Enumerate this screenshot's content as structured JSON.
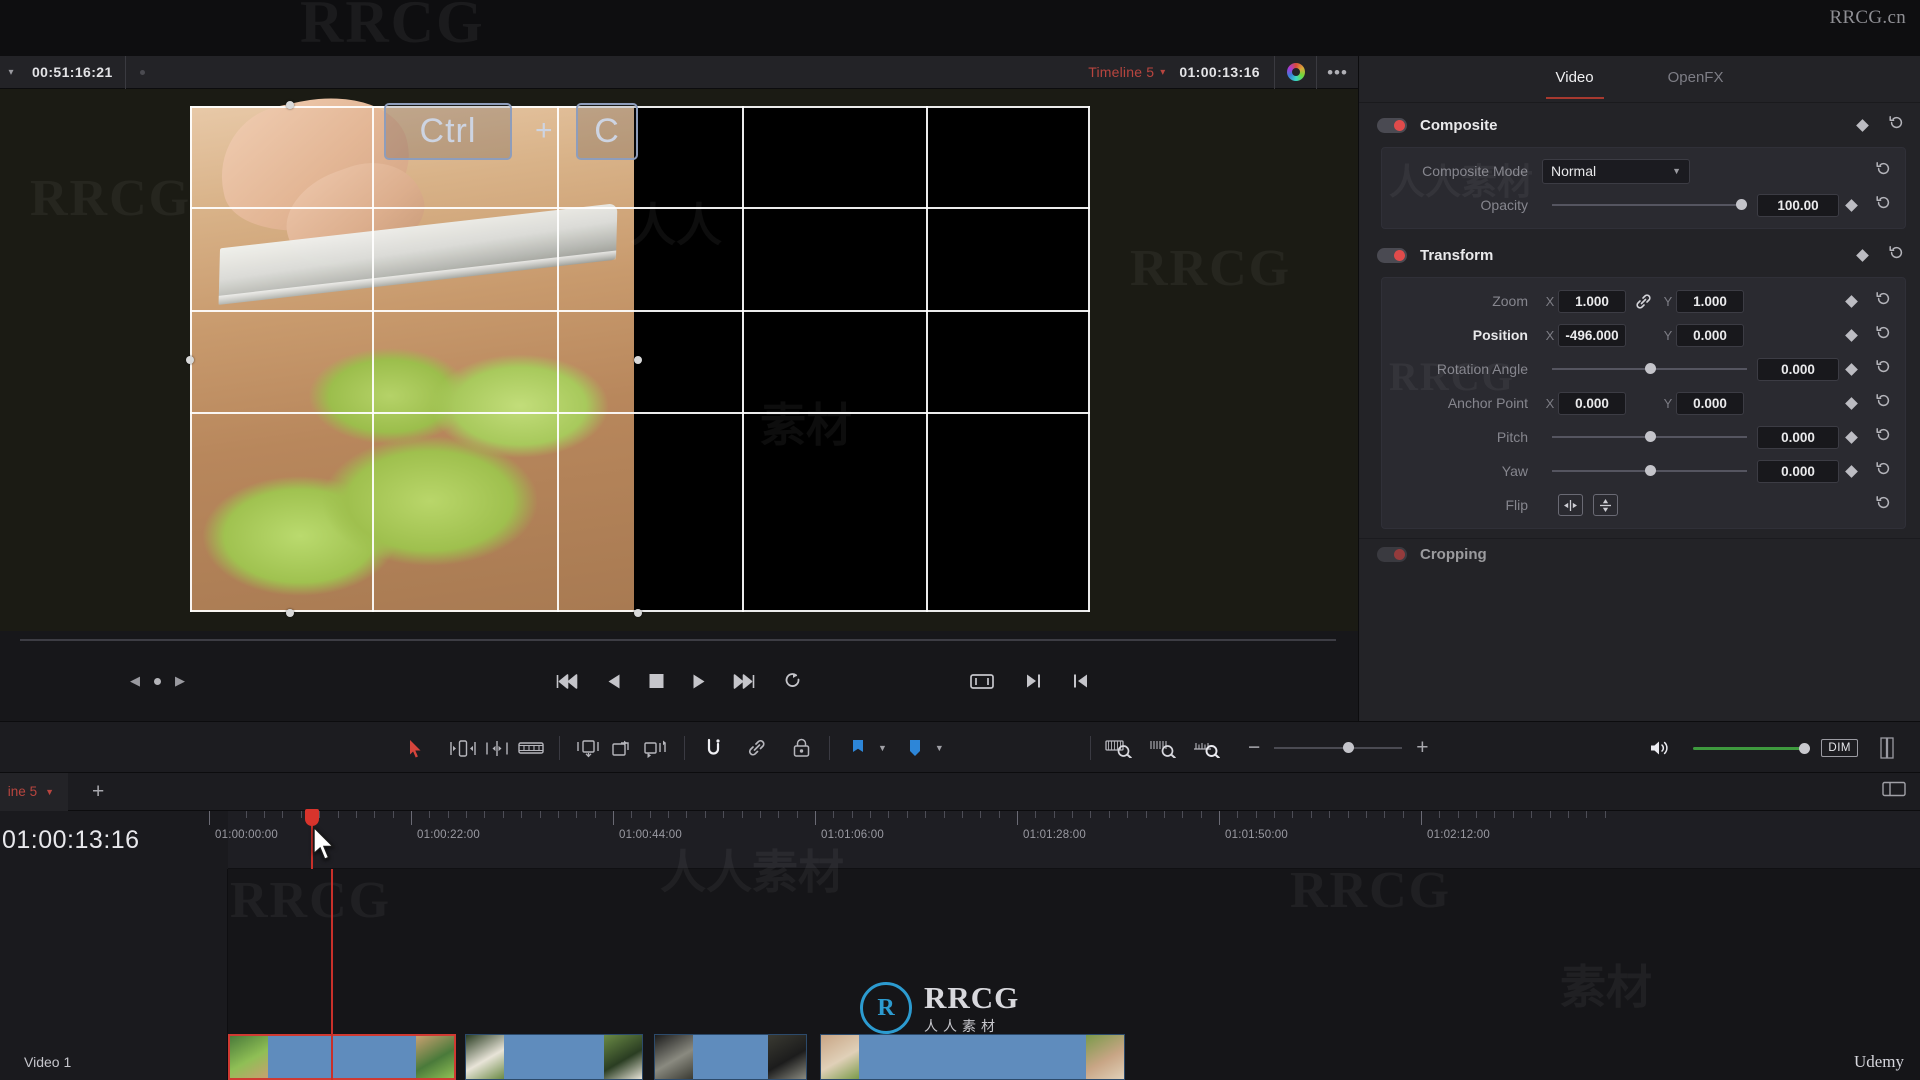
{
  "branding": {
    "top_right_watermark": "RRCG.cn",
    "bottom_right": "Udemy",
    "logo_mark": "R",
    "logo_text": "RRCG",
    "logo_subtext": "人人素材",
    "watermark_text": "RRCG",
    "watermark_cn": "人人素材"
  },
  "viewer": {
    "source_timecode": "00:51:16:21",
    "timeline_name": "Timeline 5",
    "current_timecode": "01:00:13:16",
    "color_icon": "color-wheel-icon",
    "options_icon": "options-ellipsis-icon",
    "key_overlay": {
      "key1": "Ctrl",
      "plus": "+",
      "key2": "C"
    },
    "transport": [
      {
        "name": "skip-to-start-button",
        "glyph": "first-frame"
      },
      {
        "name": "play-reverse-button",
        "glyph": "reverse"
      },
      {
        "name": "stop-button",
        "glyph": "stop"
      },
      {
        "name": "play-forward-button",
        "glyph": "play"
      },
      {
        "name": "skip-to-end-button",
        "glyph": "last-frame"
      },
      {
        "name": "loop-button",
        "glyph": "loop"
      }
    ]
  },
  "inspector": {
    "tabs": [
      {
        "label": "Video",
        "active": true
      },
      {
        "label": "OpenFX",
        "active": false
      }
    ],
    "sections": [
      {
        "title": "Composite",
        "enabled": true,
        "rows": [
          {
            "label": "Composite Mode",
            "type": "select",
            "value": "Normal"
          },
          {
            "label": "Opacity",
            "type": "slider",
            "value": "100.00",
            "knob_pct": 100
          }
        ]
      },
      {
        "title": "Transform",
        "enabled": true,
        "rows": [
          {
            "label": "Zoom",
            "type": "xy",
            "x_axis": "X",
            "x": "1.000",
            "y_axis": "Y",
            "y": "1.000",
            "linked": true
          },
          {
            "label": "Position",
            "type": "xy",
            "x_axis": "X",
            "x": "-496.000",
            "y_axis": "Y",
            "y": "0.000",
            "bold": true
          },
          {
            "label": "Rotation Angle",
            "type": "slider",
            "value": "0.000",
            "knob_pct": 50
          },
          {
            "label": "Anchor Point",
            "type": "xy",
            "x_axis": "X",
            "x": "0.000",
            "y_axis": "Y",
            "y": "0.000"
          },
          {
            "label": "Pitch",
            "type": "slider",
            "value": "0.000",
            "knob_pct": 50
          },
          {
            "label": "Yaw",
            "type": "slider",
            "value": "0.000",
            "knob_pct": 50
          },
          {
            "label": "Flip",
            "type": "flip",
            "h_icon": "flip-horizontal-icon",
            "v_icon": "flip-vertical-icon"
          }
        ]
      },
      {
        "title": "Cropping",
        "enabled": true,
        "rows": []
      }
    ]
  },
  "toolbar": {
    "left_tools": [
      {
        "name": "selection-mode-icon",
        "label": "Selection"
      },
      {
        "name": "trim-edit-mode-icon",
        "label": "Trim Edit Mode"
      },
      {
        "name": "dynamic-trim-mode-icon",
        "label": "Dynamic Trim Mode"
      },
      {
        "name": "razor-edit-icon",
        "label": "Blade Edit Mode"
      },
      {
        "name": "insert-clip-icon",
        "label": "Insert Clip"
      },
      {
        "name": "overwrite-clip-icon",
        "label": "Overwrite Clip"
      },
      {
        "name": "replace-clip-icon",
        "label": "Replace Clip"
      },
      {
        "name": "snapping-icon",
        "label": "Snapping"
      },
      {
        "name": "link-clips-icon",
        "label": "Linked Selection"
      },
      {
        "name": "lock-track-icon",
        "label": "Position Lock"
      },
      {
        "name": "flag-icon",
        "label": "Flag"
      },
      {
        "name": "marker-icon",
        "label": "Marker"
      }
    ],
    "right_tools": [
      {
        "name": "zoom-to-fit-icon",
        "label": "Fit Timeline"
      },
      {
        "name": "detail-zoom-icon",
        "label": "Detail Zoom"
      },
      {
        "name": "custom-zoom-icon",
        "label": "Custom Zoom"
      }
    ],
    "zoom_minus": "−",
    "zoom_plus": "+",
    "audio": {
      "volume_icon": "speaker-icon",
      "dim_label": "DIM",
      "meter_icon": "audio-meter-icon"
    }
  },
  "timeline": {
    "tab_label": "ine 5",
    "add_tab": "+",
    "playhead_timecode": "01:00:13:16",
    "ruler_labels": [
      "01:00:00:00",
      "01:00:22:00",
      "01:00:44:00",
      "01:01:06:00",
      "01:01:28:00",
      "01:01:50:00",
      "01:02:12:00"
    ],
    "tracks": [
      {
        "name": "Video 1",
        "clips": [
          {
            "selected": true,
            "left_pct": 0.0,
            "width_pct": 13.5
          },
          {
            "selected": false,
            "left_pct": 14.0,
            "width_pct": 10.5
          },
          {
            "selected": false,
            "left_pct": 25.2,
            "width_pct": 9.0
          },
          {
            "selected": false,
            "left_pct": 35.0,
            "width_pct": 18.0
          }
        ]
      }
    ]
  }
}
